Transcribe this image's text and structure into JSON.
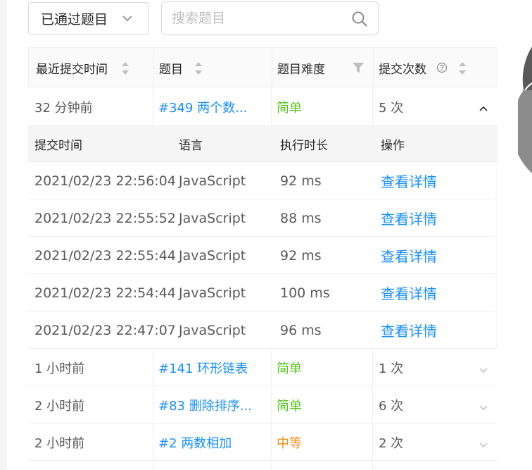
{
  "filter": {
    "selected": "已通过题目"
  },
  "search": {
    "placeholder": "搜索题目"
  },
  "table": {
    "headers": {
      "time": "最近提交时间",
      "problem": "题目",
      "difficulty": "题目难度",
      "count": "提交次数"
    },
    "expanded_row": {
      "time": "32 分钟前",
      "problem": "#349 两个数...",
      "difficulty": "简单",
      "count": "5 次"
    },
    "sub_headers": {
      "time": "提交时间",
      "language": "语言",
      "runtime": "执行时长",
      "action": "操作"
    },
    "submissions": [
      {
        "time": "2021/02/23 22:56:04",
        "language": "JavaScript",
        "runtime": "92 ms",
        "action": "查看详情"
      },
      {
        "time": "2021/02/23 22:55:52",
        "language": "JavaScript",
        "runtime": "88 ms",
        "action": "查看详情"
      },
      {
        "time": "2021/02/23 22:55:44",
        "language": "JavaScript",
        "runtime": "92 ms",
        "action": "查看详情"
      },
      {
        "time": "2021/02/23 22:54:44",
        "language": "JavaScript",
        "runtime": "100 ms",
        "action": "查看详情"
      },
      {
        "time": "2021/02/23 22:47:07",
        "language": "JavaScript",
        "runtime": "96 ms",
        "action": "查看详情"
      }
    ],
    "rows": [
      {
        "time": "1 小时前",
        "problem": "#141 环形链表",
        "difficulty": "简单",
        "count": "1 次"
      },
      {
        "time": "2 小时前",
        "problem": "#83 删除排序...",
        "difficulty": "简单",
        "count": "6 次"
      },
      {
        "time": "2 小时前",
        "problem": "#2 两数相加",
        "difficulty": "中等",
        "count": "2 次"
      }
    ]
  },
  "colors": {
    "link": "#1890ff",
    "easy": "#52c41a",
    "medium": "#fa8c16",
    "header_bg": "#fafafa",
    "donut_dark": "#595959",
    "donut_light": "#8c8c8c"
  },
  "icons": {
    "filter_chevron": "chevron-down-icon",
    "search": "search-icon",
    "sort": "sort-icon",
    "filter": "filter-icon",
    "help": "question-circle-icon",
    "collapse": "chevron-up-icon",
    "expand": "chevron-down-icon"
  }
}
